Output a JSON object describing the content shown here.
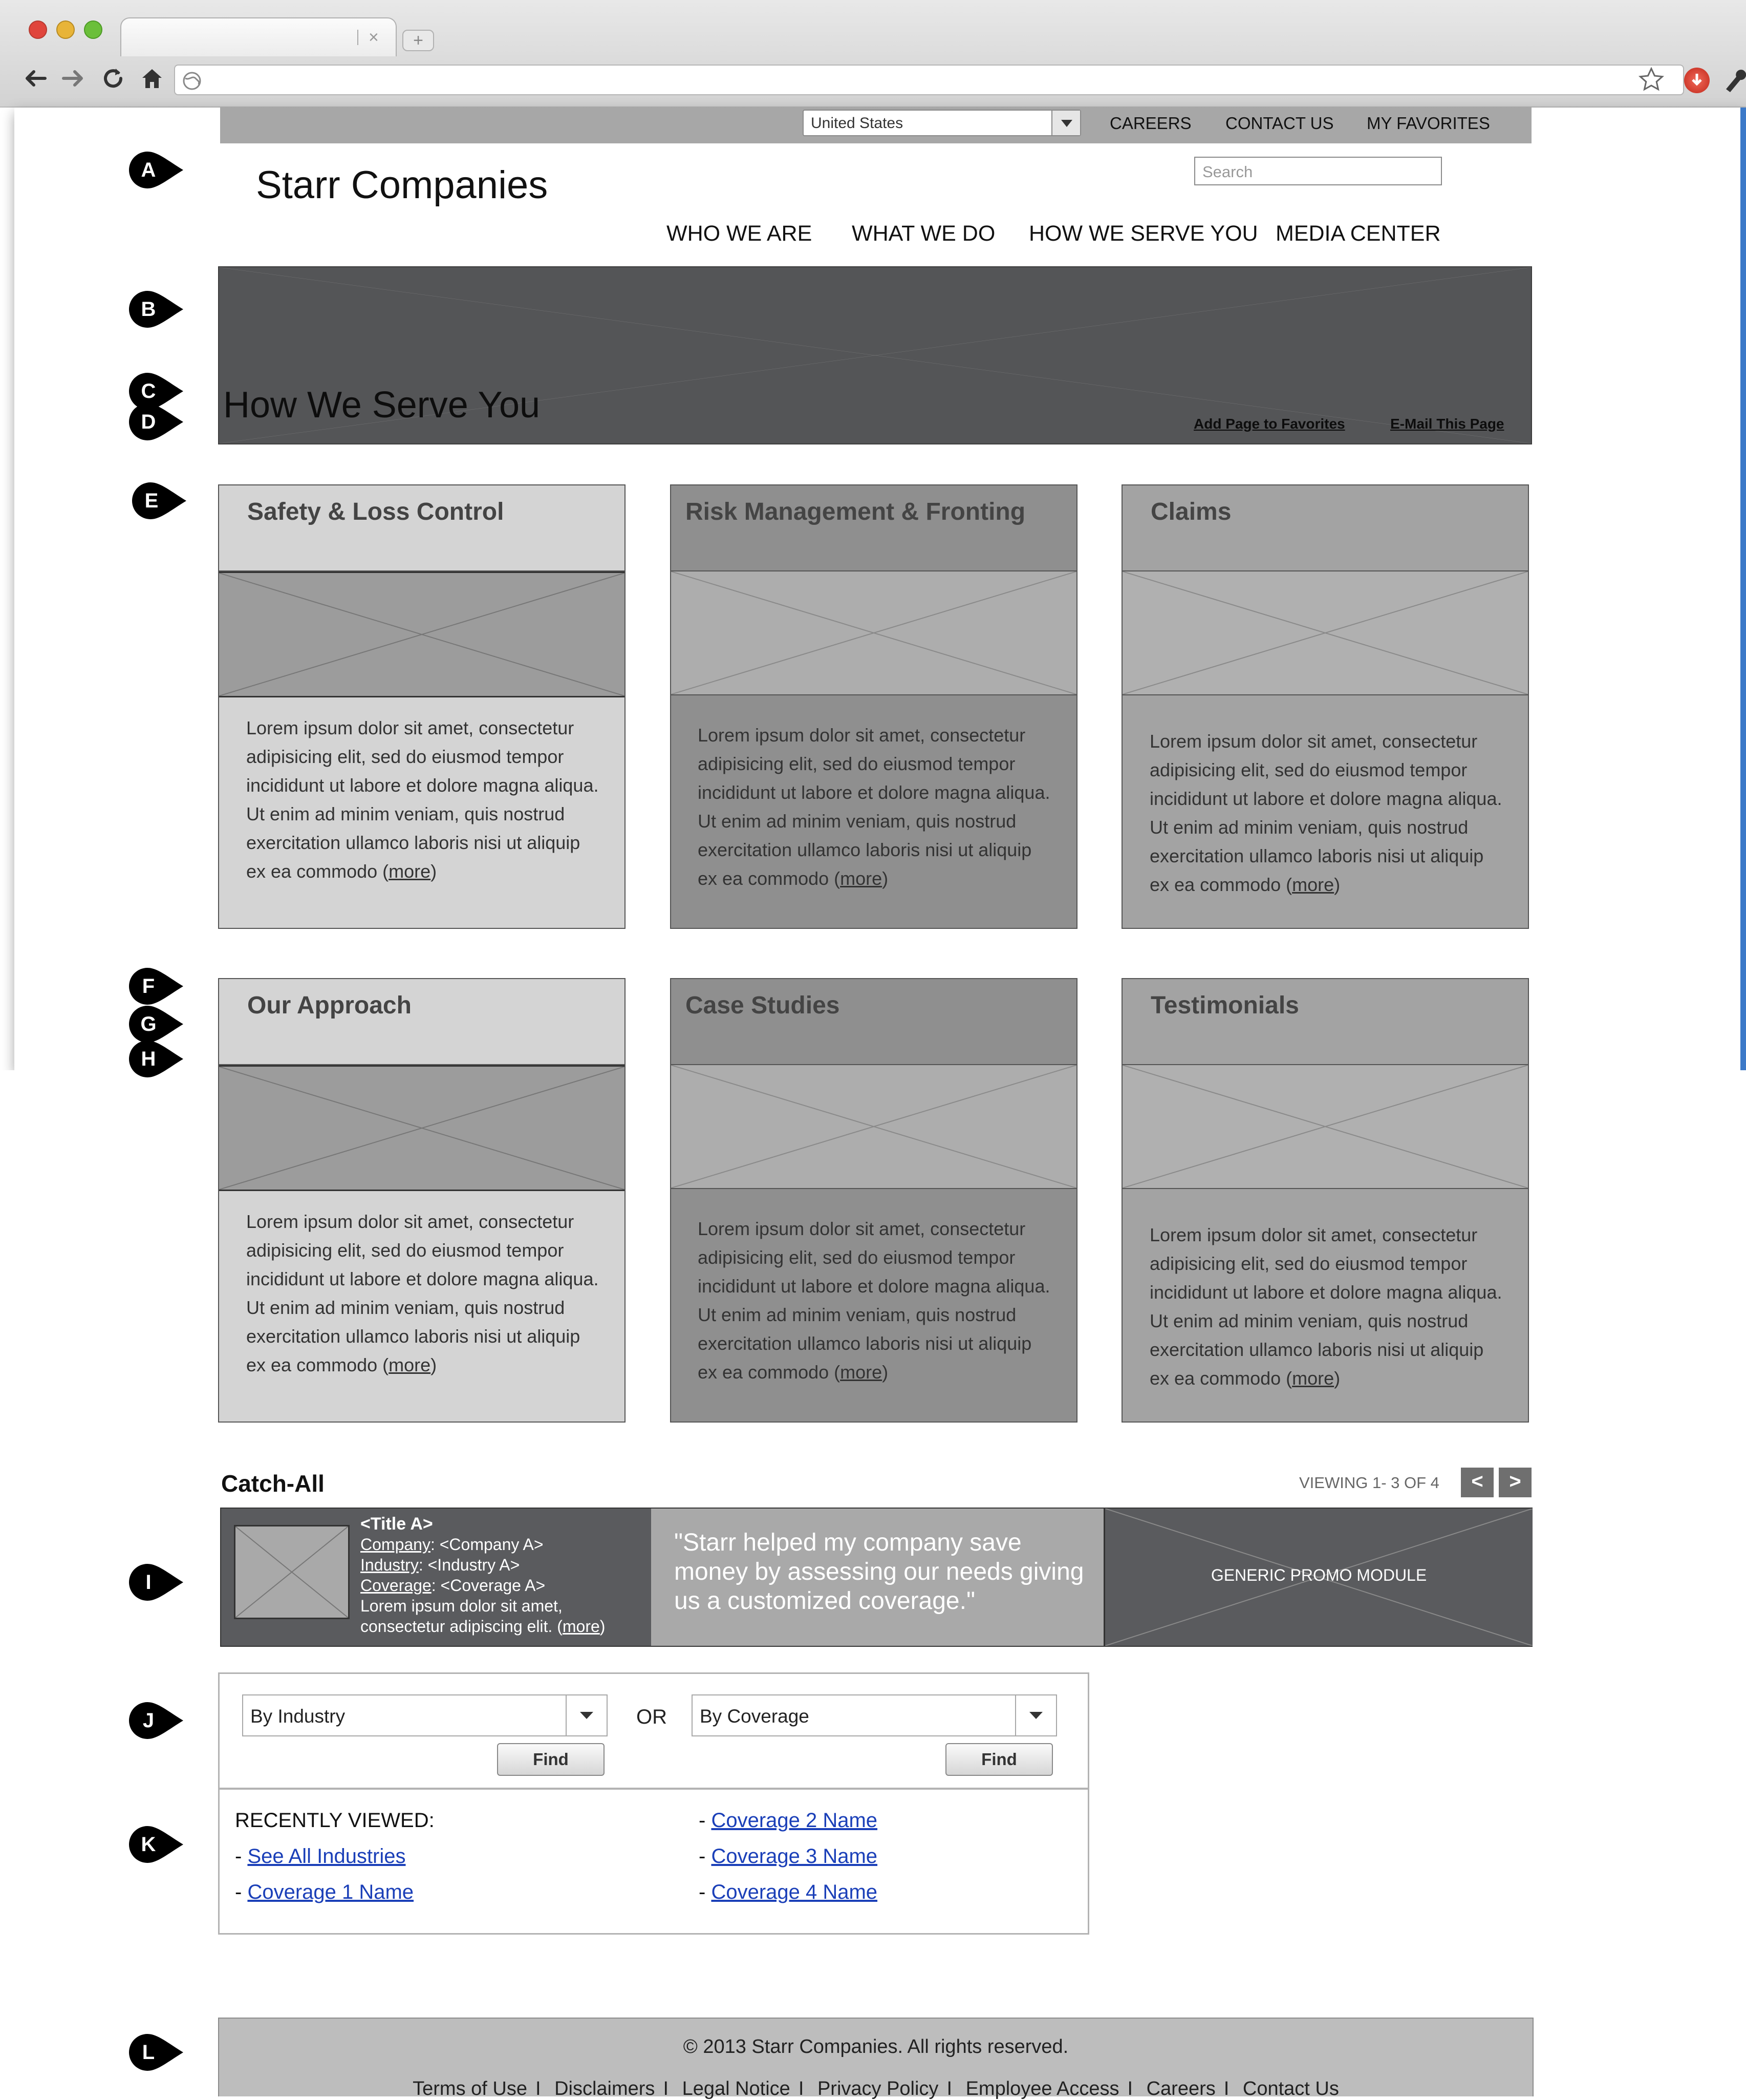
{
  "browser": {
    "tab_title": "",
    "url": "",
    "nav_icons": [
      "back-arrow-icon",
      "forward-arrow-icon",
      "reload-icon",
      "home-icon"
    ],
    "toolbar_icons": [
      "bookmark-star-icon",
      "extension-red-icon",
      "wrench-icon"
    ]
  },
  "utility": {
    "country_selected": "United States",
    "links": [
      "CAREERS",
      "CONTACT US",
      "MY FAVORITES"
    ]
  },
  "header": {
    "logo": "Starr Companies",
    "search_placeholder": "Search",
    "nav": [
      "WHO WE ARE",
      "WHAT WE DO",
      "HOW WE SERVE YOU",
      "MEDIA CENTER"
    ]
  },
  "hero": {
    "title": "How We Serve You",
    "add_favorites": "Add Page to Favorites",
    "email_page": "E-Mail This Page"
  },
  "callouts": [
    "A",
    "B",
    "C",
    "D",
    "E",
    "F",
    "G",
    "H",
    "I",
    "J",
    "K",
    "L"
  ],
  "cards": [
    {
      "title": "Safety & Loss Control",
      "body": "Lorem ipsum dolor sit amet, consectetur adipisicing elit, sed do eiusmod tempor incididunt ut labore et dolore magna aliqua. Ut enim ad minim veniam, quis nostrud exercitation ullamco laboris nisi ut aliquip ex ea commodo (",
      "more": "more",
      "close": ")"
    },
    {
      "title": "Risk Management & Fronting",
      "body": "Lorem ipsum dolor sit amet, consectetur adipisicing elit, sed do eiusmod tempor incididunt ut labore et dolore magna aliqua. Ut enim ad minim veniam, quis nostrud exercitation ullamco laboris nisi ut aliquip ex ea commodo (",
      "more": "more",
      "close": ")"
    },
    {
      "title": "Claims",
      "body": "Lorem ipsum dolor sit amet, consectetur adipisicing elit, sed do eiusmod tempor incididunt ut labore et dolore magna aliqua. Ut enim ad minim veniam, quis nostrud exercitation ullamco laboris nisi ut aliquip ex ea commodo (",
      "more": "more",
      "close": ")"
    },
    {
      "title": "Our Approach",
      "body": "Lorem ipsum dolor sit amet, consectetur adipisicing elit, sed do eiusmod tempor incididunt ut labore et dolore magna aliqua. Ut enim ad minim veniam, quis nostrud exercitation ullamco laboris nisi ut aliquip ex ea commodo (",
      "more": "more",
      "close": ")"
    },
    {
      "title": "Case Studies",
      "body": "Lorem ipsum dolor sit amet, consectetur adipisicing elit, sed do eiusmod tempor incididunt ut labore et dolore magna aliqua. Ut enim ad minim veniam, quis nostrud exercitation ullamco laboris nisi ut aliquip ex ea commodo (",
      "more": "more",
      "close": ")"
    },
    {
      "title": "Testimonials",
      "body": "Lorem ipsum dolor sit amet, consectetur adipisicing elit, sed do eiusmod tempor incididunt ut labore et dolore magna aliqua. Ut enim ad minim veniam, quis nostrud exercitation ullamco laboris nisi ut aliquip ex ea commodo (",
      "more": "more",
      "close": ")"
    }
  ],
  "catch_all": {
    "title": "Catch-All",
    "viewing": "VIEWING 1- 3 OF 4",
    "prev": "<",
    "next": ">",
    "item_title": "<Title A>",
    "company_label": "Company",
    "company_value": ": <Company A>",
    "industry_label": "Industry",
    "industry_value": ": <Industry A>",
    "coverage_label": "Coverage",
    "coverage_value": ": <Coverage A>",
    "body_line1": "Lorem ipsum dolor sit amet,",
    "body_line2": "consectetur adipiscing elit. (",
    "more": "more",
    "close": ")",
    "quote": "\"Starr helped my company save money by assessing our needs giving us a customized coverage.\"",
    "promo": "GENERIC PROMO MODULE"
  },
  "finder": {
    "industry_select": "By Industry",
    "or_label": "OR",
    "coverage_select": "By Coverage",
    "find_label": "Find",
    "recently_viewed": "RECENTLY VIEWED:",
    "left_links": [
      "See All Industries",
      "Coverage 1 Name"
    ],
    "right_links": [
      "Coverage 2 Name",
      "Coverage 3 Name",
      "Coverage 4 Name"
    ],
    "bullet": "- "
  },
  "footer": {
    "copyright": "© 2013 Starr Companies. All rights reserved.",
    "links": [
      "Terms of Use",
      "Disclaimers",
      "Legal Notice",
      "Privacy Policy",
      "Employee Access",
      "Careers",
      "Contact Us"
    ],
    "separator": "I"
  },
  "colors": {
    "util_bar": "#a7a7a7",
    "hero": "#545557",
    "card_light": "#d4d4d4",
    "card_dark": "#8f8f8f",
    "card_mid": "#a3a3a3",
    "link_blue": "#1a3fb8",
    "footer": "#bdbdbd"
  }
}
